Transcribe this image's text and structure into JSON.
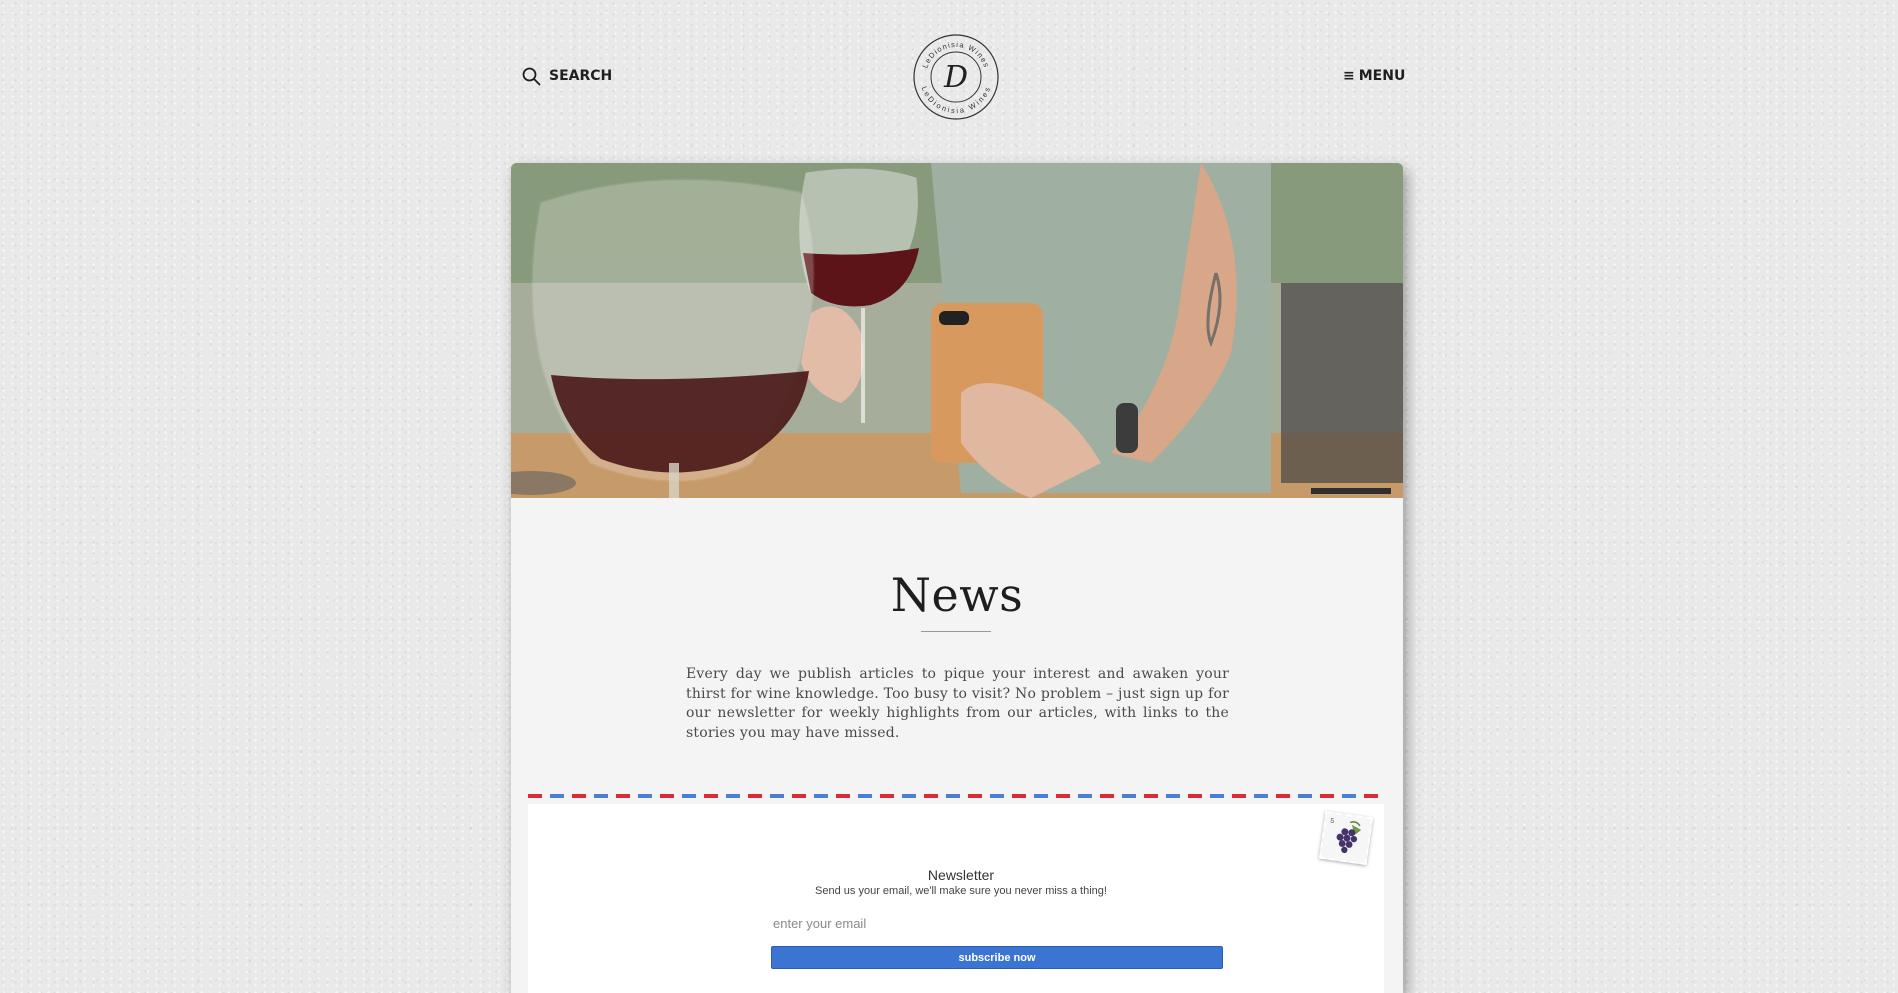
{
  "header": {
    "search_label": "SEARCH",
    "menu_label": "MENU",
    "menu_glyph": "≡",
    "logo_letter": "D",
    "logo_ring_text": "LeDionisia Wines"
  },
  "icons": {
    "search": "search-icon",
    "menu": "hamburger-icon",
    "stamp": "grape-stamp-icon"
  },
  "hero": {
    "description_icon": "hero-image"
  },
  "page": {
    "title": "News",
    "intro": "Every day we publish articles to pique your interest and awaken your thirst for wine knowledge. Too busy to visit? No problem – just sign up for our newsletter for weekly highlights from our articles, with links to the stories you may have missed."
  },
  "newsletter": {
    "title": "Newsletter",
    "subtitle": "Send us your email, we'll make sure you never miss a thing!",
    "email_placeholder": "enter your email",
    "email_value": "",
    "button_label": "subscribe now",
    "stamp_value": "5"
  },
  "colors": {
    "airmail_red": "#d82d36",
    "airmail_blue": "#4a7fd4",
    "button_blue": "#3c74d2"
  }
}
